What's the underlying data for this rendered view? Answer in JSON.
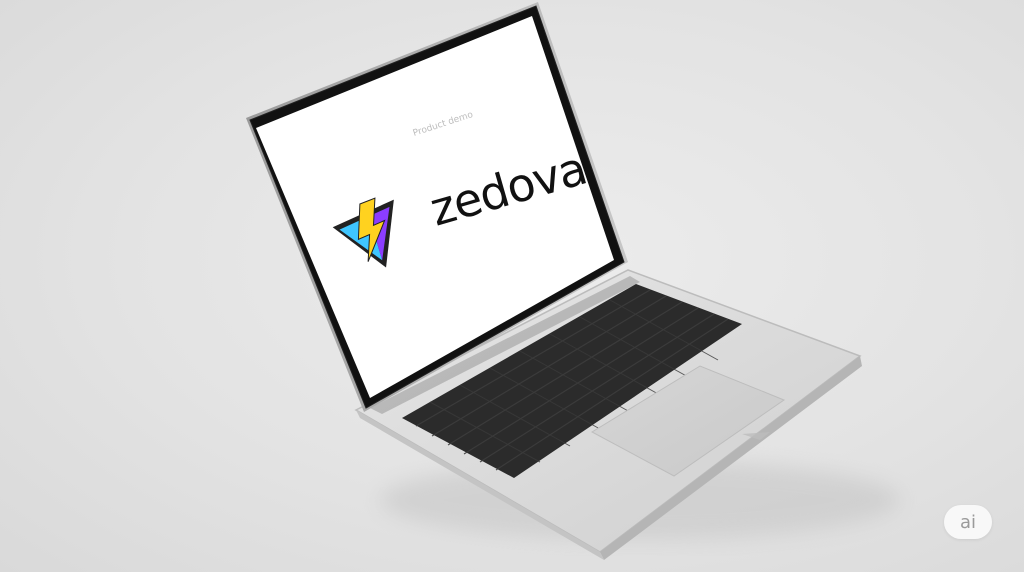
{
  "screen": {
    "brand_name": "zedova",
    "faint_text": "Product demo",
    "background_color": "#ffffff",
    "logo_colors": {
      "left_facet": "#3fc6ff",
      "right_facet": "#8b3dff",
      "bolt": "#ffd21f",
      "outline": "#222222"
    }
  },
  "laptop": {
    "body_color": "#dcdcdc",
    "keyboard_color": "#2b2b2b",
    "bezel_color": "#111111"
  },
  "badge": {
    "label": "ai"
  }
}
